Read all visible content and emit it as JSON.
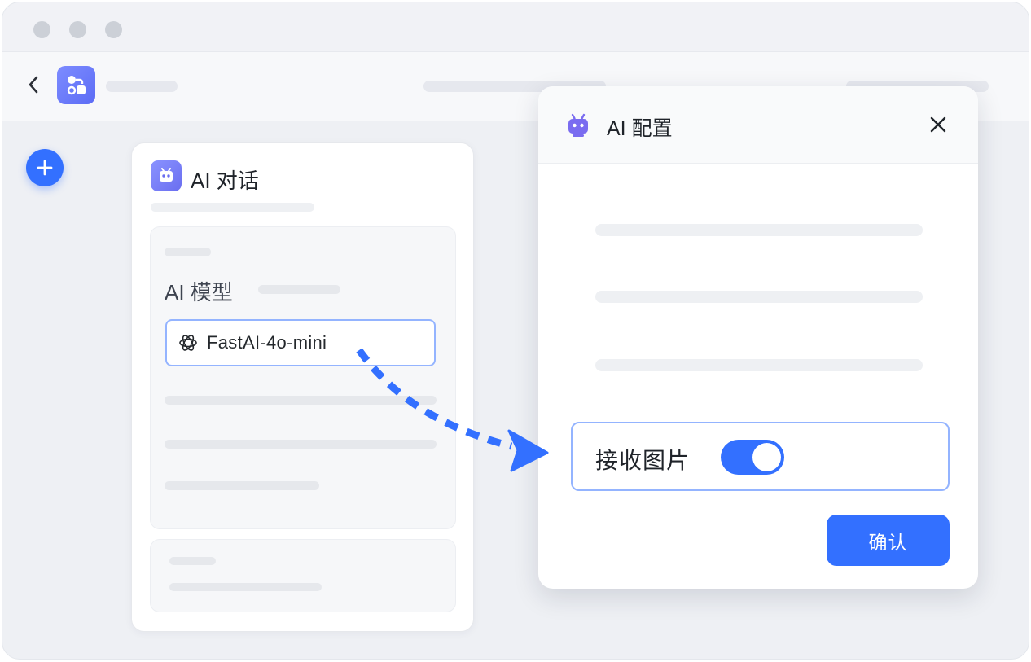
{
  "window": {
    "traffic_lights": [
      "close",
      "minimize",
      "maximize"
    ]
  },
  "toolbar": {
    "back_icon": "chevron-left-icon",
    "app_icon": "workflow-icon"
  },
  "fab": {
    "icon": "plus-icon"
  },
  "node_card": {
    "icon": "robot-icon",
    "title": "AI 对话",
    "model_label": "AI 模型",
    "model_value": "FastAI-4o-mini",
    "model_icon": "openai-icon"
  },
  "modal": {
    "icon": "robot-icon",
    "title": "AI 配置",
    "close_icon": "close-icon",
    "toggle_label": "接收图片",
    "toggle_on": true,
    "confirm_label": "确认"
  },
  "colors": {
    "accent": "#3370ff",
    "focus_border": "#94b4ff",
    "robot_purple": "#6a6ef0"
  }
}
